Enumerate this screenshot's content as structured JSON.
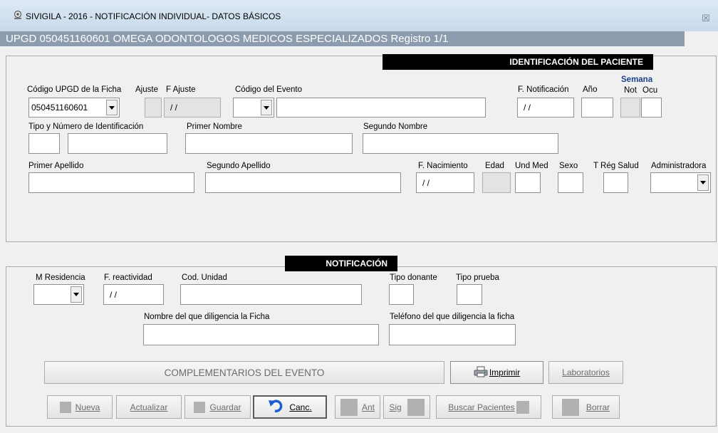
{
  "window": {
    "title": "SIVIGILA - 2016 -  NOTIFICACIÓN INDIVIDUAL- DATOS BÁSICOS",
    "close_glyph": "☒",
    "upgd_bar": "UPGD 050451160601 OMEGA ODONTOLOGOS MEDICOS ESPECIALIZADOS Registro 1/1"
  },
  "patient": {
    "header": "IDENTIFICACIÓN DEL PACIENTE",
    "labels": {
      "codigo_upgd": "Código UPGD de la Ficha",
      "ajuste": "Ajuste",
      "f_ajuste": "F Ajuste",
      "codigo_evento": "Código del Evento",
      "f_notificacion": "F. Notificación",
      "anio": "Año",
      "semana": "Semana",
      "not": "Not",
      "ocu": "Ocu",
      "tipo_id": "Tipo y Número de Identificación",
      "primer_nombre": "Primer Nombre",
      "segundo_nombre": "Segundo Nombre",
      "primer_apellido": "Primer Apellido",
      "segundo_apellido": "Segundo Apellido",
      "f_nacimiento": "F. Nacimiento",
      "edad": "Edad",
      "und_med": "Und Med",
      "sexo": "Sexo",
      "t_reg_salud": "T Rég Salud",
      "administradora": "Administradora"
    },
    "values": {
      "codigo_upgd": "050451160601",
      "f_ajuste": "/ /",
      "f_notificacion": "/ /",
      "f_nacimiento": "/ /"
    }
  },
  "notification": {
    "header": "NOTIFICACIÓN",
    "labels": {
      "m_residencia": "M Residencia",
      "f_reactividad": "F. reactividad",
      "cod_unidad": "Cod. Unidad",
      "tipo_donante": "Tipo donante",
      "tipo_prueba": "Tipo prueba",
      "nombre_diligencia": "Nombre del que diligencia la Ficha",
      "telefono_diligencia": "Teléfono del que diligencia la ficha"
    },
    "values": {
      "f_reactividad": "/ /"
    }
  },
  "buttons": {
    "complementarios": "COMPLEMENTARIOS DEL EVENTO",
    "imprimir": "Imprimir",
    "laboratorios": "Laboratorios",
    "nueva": "Nueva",
    "actualizar": "Actualizar",
    "guardar": "Guardar",
    "canc": "Canc.",
    "ant": "Ant",
    "sig": "Sig",
    "buscar": "Buscar Pacientes",
    "borrar": "Borrar"
  },
  "colors": {
    "upgd_bar": "#8c9cae",
    "semana_label": "#1f3f8f",
    "undo_icon": "#1e5fd0"
  }
}
